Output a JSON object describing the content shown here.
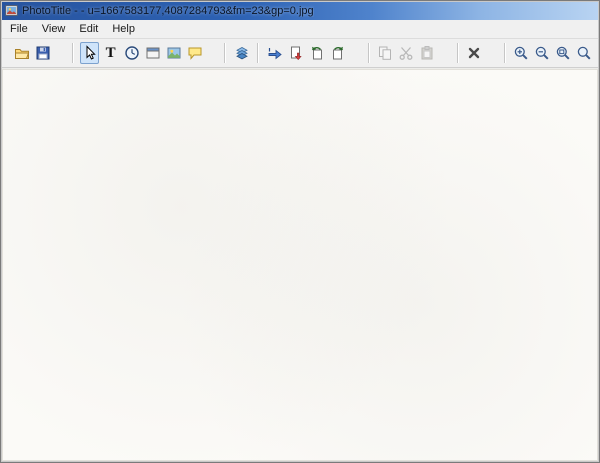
{
  "window": {
    "title": "PhotoTitle - - u=1667583177,4087284793&fm=23&gp=0.jpg"
  },
  "menu": {
    "items": [
      {
        "label": "File"
      },
      {
        "label": "View"
      },
      {
        "label": "Edit"
      },
      {
        "label": "Help"
      }
    ]
  },
  "toolbar": {
    "text_tool_glyph": "T",
    "selected_tool": "select",
    "buttons": [
      {
        "name": "open",
        "icon": "folder-open-icon",
        "enabled": true
      },
      {
        "name": "save",
        "icon": "floppy-disk-icon",
        "enabled": true
      },
      {
        "name": "select",
        "icon": "cursor-arrow-icon",
        "enabled": true,
        "selected": true
      },
      {
        "name": "text",
        "icon": "text-T-icon",
        "enabled": true
      },
      {
        "name": "clock",
        "icon": "clock-icon",
        "enabled": true
      },
      {
        "name": "window-capture",
        "icon": "window-icon",
        "enabled": true
      },
      {
        "name": "image",
        "icon": "image-icon",
        "enabled": true
      },
      {
        "name": "callout",
        "icon": "speech-bubble-icon",
        "enabled": true
      },
      {
        "name": "rotate-3d",
        "icon": "layer-stack-icon",
        "enabled": true
      },
      {
        "name": "flip",
        "icon": "flip-arrow-icon",
        "enabled": true
      },
      {
        "name": "export-page",
        "icon": "page-down-arrow-icon",
        "enabled": true
      },
      {
        "name": "rotate-left",
        "icon": "rotate-left-icon",
        "enabled": true
      },
      {
        "name": "rotate-right",
        "icon": "rotate-right-icon",
        "enabled": true
      },
      {
        "name": "copy",
        "icon": "copy-icon",
        "enabled": false
      },
      {
        "name": "cut",
        "icon": "scissors-icon",
        "enabled": false
      },
      {
        "name": "paste",
        "icon": "paste-icon",
        "enabled": false
      },
      {
        "name": "delete",
        "icon": "delete-x-icon",
        "enabled": true
      },
      {
        "name": "zoom-in",
        "icon": "zoom-in-icon",
        "enabled": true
      },
      {
        "name": "zoom-out",
        "icon": "zoom-out-icon",
        "enabled": true
      },
      {
        "name": "zoom-fit",
        "icon": "zoom-fit-icon",
        "enabled": true
      },
      {
        "name": "zoom-actual",
        "icon": "zoom-actual-icon",
        "enabled": true
      }
    ]
  },
  "colors": {
    "titlebar_left": "#27549f",
    "titlebar_right": "#b9d4f2",
    "selected_tool_bg": "#cfe4fa",
    "selected_tool_border": "#7da2ce",
    "canvas_bg": "#fbfaf7",
    "toolbar_bg": "#f0f0f0"
  }
}
